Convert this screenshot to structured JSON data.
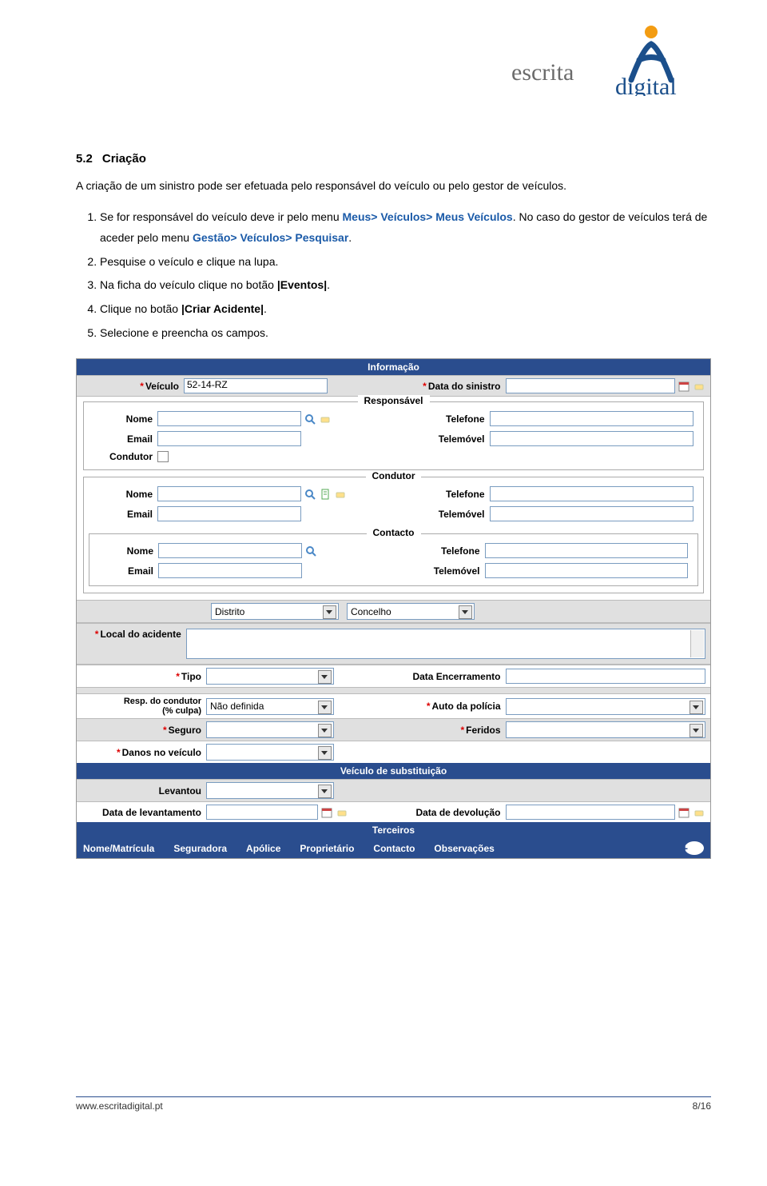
{
  "logo": {
    "word_left": "escrita",
    "word_right": "digital"
  },
  "section": {
    "number": "5.2",
    "title": "Criação"
  },
  "intro": "A criação de um sinistro pode ser efetuada pelo responsável do veículo ou pelo gestor de veículos.",
  "steps": {
    "s1a": "Se for responsável do veículo deve ir pelo menu ",
    "s1_menu1": "Meus> Veículos> Meus Veículos",
    "s1b": ". No caso do gestor de veículos terá de aceder pelo menu ",
    "s1_menu2": "Gestão> Veículos> Pesquisar",
    "s1c": ".",
    "s2": "Pesquise o veículo e clique na lupa.",
    "s3a": "Na ficha do veículo clique no botão ",
    "s3_btn": "|Eventos|",
    "s3b": ".",
    "s4a": "Clique no botão ",
    "s4_btn": "|Criar Acidente|",
    "s4b": ".",
    "s5": "Selecione e preencha os campos."
  },
  "form": {
    "header_info": "Informação",
    "veiculo_label": "Veículo",
    "veiculo_value": "52-14-RZ",
    "data_sinistro_label": "Data do sinistro",
    "fs_responsavel": "Responsável",
    "fs_condutor": "Condutor",
    "fs_contacto": "Contacto",
    "nome": "Nome",
    "email": "Email",
    "telefone": "Telefone",
    "telemovel": "Telemóvel",
    "condutor_chk": "Condutor",
    "distrito": "Distrito",
    "concelho": "Concelho",
    "local": "Local do acidente",
    "tipo": "Tipo",
    "data_enc": "Data Encerramento",
    "resp_cond_l1": "Resp. do condutor",
    "resp_cond_l2": "(% culpa)",
    "nao_def": "Não definida",
    "auto_pol": "Auto da polícia",
    "seguro": "Seguro",
    "feridos": "Feridos",
    "danos": "Danos no veículo",
    "veic_subst": "Veículo de substituição",
    "levantou": "Levantou",
    "data_lev": "Data de levantamento",
    "data_dev": "Data de devolução",
    "terceiros": "Terceiros",
    "col1": "Nome/Matrícula",
    "col2": "Seguradora",
    "col3": "Apólice",
    "col4": "Proprietário",
    "col5": "Contacto",
    "col6": "Observações"
  },
  "footer": {
    "url": "www.escritadigital.pt",
    "page": "8/16"
  }
}
